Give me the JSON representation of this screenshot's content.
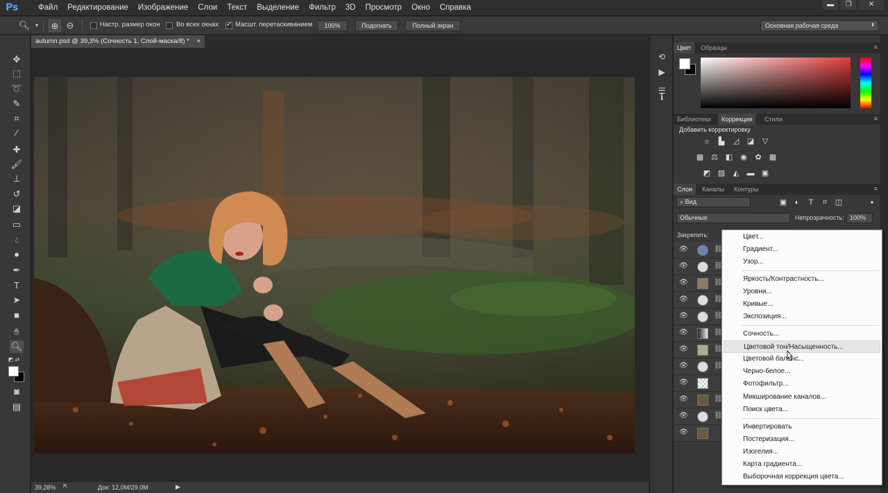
{
  "app": {
    "logo": "Ps"
  },
  "menu": [
    "Файл",
    "Редактирование",
    "Изображение",
    "Слои",
    "Текст",
    "Выделение",
    "Фильтр",
    "3D",
    "Просмотр",
    "Окно",
    "Справка"
  ],
  "window_controls": {
    "minimize": "▬",
    "restore": "❐",
    "close": "✕"
  },
  "options": {
    "resize_windows": "Настр. размер окон",
    "resize_windows_checked": false,
    "all_windows": "Во всех окнах",
    "all_windows_checked": false,
    "scrubby_zoom": "Масшт. перетаскиванием",
    "scrubby_zoom_checked": true,
    "zoom_100": "100%",
    "fit": "Подогнать",
    "fullscreen": "Полный экран",
    "workspace": "Основная рабочая среда"
  },
  "document": {
    "tab_title": "autumn.psd @ 39,3% (Сочность 1, Слой-маска/8) *",
    "close": "×"
  },
  "status": {
    "zoom": "39,28%",
    "doc": "Док: 12,0M/29,0M"
  },
  "panels": {
    "color_tabs": [
      "Цвет",
      "Образцы"
    ],
    "adjust_tabs": [
      "Библиотеки",
      "Коррекция",
      "Стили"
    ],
    "adjust_header": "Добавить корректировку",
    "layers_tabs": [
      "Слои",
      "Каналы",
      "Контуры"
    ],
    "filter_kind": "Вид",
    "blend_mode": "Обычные",
    "opacity_label": "Непрозрачность:",
    "opacity_value": "100%",
    "lock_label": "Закрепить:"
  },
  "context_menu": {
    "items": [
      "Цвет...",
      "Градиент...",
      "Узор...",
      "Яркость/Контрастность...",
      "Уровни...",
      "Кривые...",
      "Экспозиция...",
      "Сочность...",
      "Цветовой тон/Насыщенность...",
      "Цветовой баланс...",
      "Черно-белое...",
      "Фотофильтр...",
      "Микширование каналов...",
      "Поиск цвета...",
      "Инвертировать",
      "Постеризация...",
      "Изогелия...",
      "Карта градиента...",
      "Выборочная коррекция цвета..."
    ],
    "highlighted_index": 8
  },
  "colors": {
    "accent": "#4ea0ff",
    "menu_bg": "#fbfbfb",
    "panel_bg": "#383838"
  }
}
